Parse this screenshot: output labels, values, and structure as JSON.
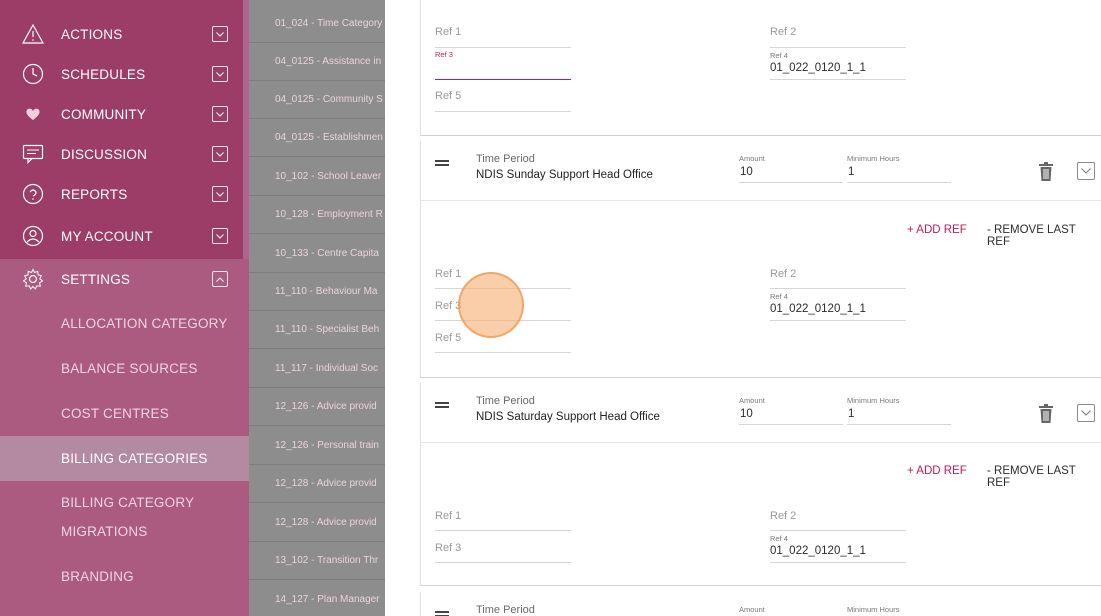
{
  "sidebar": {
    "items": [
      {
        "label": "ACTIONS",
        "icon": "warning-icon"
      },
      {
        "label": "SCHEDULES",
        "icon": "clock-icon"
      },
      {
        "label": "COMMUNITY",
        "icon": "heart-hands-icon"
      },
      {
        "label": "DISCUSSION",
        "icon": "chat-icon"
      },
      {
        "label": "REPORTS",
        "icon": "reports-icon"
      },
      {
        "label": "MY ACCOUNT",
        "icon": "user-icon"
      },
      {
        "label": "SETTINGS",
        "icon": "gear-icon"
      }
    ],
    "settings_sub": [
      {
        "label": "ALLOCATION CATEGORY"
      },
      {
        "label": "BALANCE SOURCES"
      },
      {
        "label": "COST CENTRES"
      },
      {
        "label": "BILLING CATEGORIES"
      },
      {
        "label_1": "BILLING CATEGORY",
        "label_2": "MIGRATIONS"
      },
      {
        "label": "BRANDING"
      }
    ]
  },
  "list": {
    "rows": [
      "01_024 - Time Category",
      "04_0125 - Assistance in",
      "04_0125 - Community S",
      "04_0125 - Establishmen",
      "10_102 - School Leaver",
      "10_128 - Employment R",
      "10_133 - Centre Capita",
      "11_110 - Behaviour Ma",
      "11_110 - Specialist Beh",
      "11_117 - Individual Soc",
      "12_126 - Advice provid",
      "12_126 - Personal train",
      "12_128 - Advice provid",
      "12_128 - Advice provid",
      "13_102 - Transition Thr",
      "14_127 - Plan Manager"
    ]
  },
  "panel": {
    "top_refs": {
      "ref1": "Ref 1",
      "ref2": "Ref 2",
      "ref3": "Ref 3",
      "ref4_label": "Ref 4",
      "ref4_value": "01_022_0120_1_1",
      "ref5": "Ref 5"
    },
    "period_title": "Time Period",
    "amount_label": "Amount",
    "min_hours_label": "Minimum Hours",
    "add_ref": "+ ADD REF",
    "remove_ref": "- REMOVE LAST REF",
    "sunday": {
      "name": "NDIS Sunday Support Head Office",
      "amount": "10",
      "min_hours": "1",
      "ref1": "Ref 1",
      "ref2": "Ref 2",
      "ref3": "Ref 3",
      "ref4_label": "Ref 4",
      "ref4_value": "01_022_0120_1_1",
      "ref5": "Ref 5"
    },
    "saturday": {
      "name": "NDIS Saturday Support Head Office",
      "amount": "10",
      "min_hours": "1",
      "ref1": "Ref 1",
      "ref2": "Ref 2",
      "ref3": "Ref 3",
      "ref4_label": "Ref 4",
      "ref4_value": "01_022_0120_1_1"
    },
    "bottom": {
      "title": "Time Period",
      "amount_label": "Amount",
      "min_hours_label": "Minimum Hours"
    }
  },
  "colors": {
    "sidebar": "#9b3d67",
    "accent": "#c2185b",
    "active_item": "#b48aa0"
  }
}
